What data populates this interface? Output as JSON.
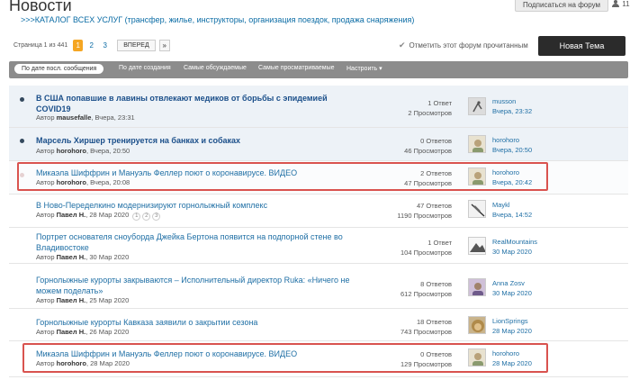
{
  "header": {
    "title": "Новости",
    "catalog_link": ">>>КАТАЛОГ ВСЕХ УСЛУГ (трансфер, жилье, инструкторы, организация поездок, продажа снаряжения)",
    "subscribe_label": "Подписаться на форум",
    "members_count": "11"
  },
  "pager": {
    "label": "Страница 1 из 441",
    "pages": [
      "1",
      "2",
      "3"
    ],
    "next_label": "ВПЕРЕД",
    "last_label": "»"
  },
  "actions": {
    "mark_read_label": "Отметить этот форум прочитанным",
    "new_topic_label": "Новая Тема"
  },
  "sort": {
    "items": [
      "По дате посл. сообщения",
      "По дате создания",
      "Самые обсуждаемые",
      "Самые просматриваемые",
      "Настроить ▾"
    ]
  },
  "topics": [
    {
      "title": "В США попавшие в лавины отвлекают медиков от борьбы с эпидемией COVID19",
      "author_prefix": "Автор",
      "author": "mausefalle",
      "date": ", Вчера, 23:31",
      "answers": "1 Ответ",
      "views": "2 Просмотров",
      "last_user": "musson",
      "last_when": "Вчера, 23:32"
    },
    {
      "title": "Марсель Хиршер тренируется на банках и собаках",
      "author_prefix": "Автор",
      "author": "horohoro",
      "date": ", Вчера, 20:50",
      "answers": "0 Ответов",
      "views": "46 Просмотров",
      "last_user": "horohoro",
      "last_when": "Вчера, 20:50"
    },
    {
      "title": "Микаэла Шиффрин и Мануэль Феллер поют о коронавирусе. ВИДЕО",
      "author_prefix": "Автор",
      "author": "horohoro",
      "date": ", Вчера, 20:08",
      "answers": "2 Ответов",
      "views": "47 Просмотров",
      "last_user": "horohoro",
      "last_when": "Вчера, 20:42"
    },
    {
      "title": "В Ново-Переделкино модернизируют горнолыжный комплекс",
      "author_prefix": "Автор",
      "author": "Павел Н.",
      "date": ", 28 Мар 2020",
      "pages": [
        "1",
        "2",
        "3"
      ],
      "answers": "47 Ответов",
      "views": "1190 Просмотров",
      "last_user": "Maykl",
      "last_when": "Вчера, 14:52"
    },
    {
      "title": "Портрет основателя сноуборда Джейка Бертона появится на подпорной стене во Владивостоке",
      "author_prefix": "Автор",
      "author": "Павел Н.",
      "date": ", 30 Мар 2020",
      "answers": "1 Ответ",
      "views": "104 Просмотров",
      "last_user": "RealMountains",
      "last_when": "30 Мар 2020"
    },
    {
      "title": "Горнолыжные курорты закрываются – Исполнительный директор Ruka: «Ничего не можем поделать»",
      "author_prefix": "Автор",
      "author": "Павел Н.",
      "date": ", 25 Мар 2020",
      "answers": "8 Ответов",
      "views": "612 Просмотров",
      "last_user": "Anna Zosv",
      "last_when": "30 Мар 2020"
    },
    {
      "title": "Горнолыжные курорты Кавказа заявили о закрытии сезона",
      "author_prefix": "Автор",
      "author": "Павел Н.",
      "date": ", 26 Мар 2020",
      "answers": "18 Ответов",
      "views": "743 Просмотров",
      "last_user": "LionSprings",
      "last_when": "28 Мар 2020"
    },
    {
      "title": "Микаэла Шиффрин и Мануэль Феллер поют о коронавирусе. ВИДЕО",
      "author_prefix": "Автор",
      "author": "horohoro",
      "date": ", 28 Мар 2020",
      "answers": "0 Ответов",
      "views": "129 Просмотров",
      "last_user": "horohoro",
      "last_when": "28 Мар 2020"
    }
  ],
  "colors": {
    "accent_link": "#1f6fa5",
    "active_page": "#f5a623",
    "highlight_box": "#d9534f",
    "new_topic_bg": "#2b2b2b",
    "sort_bar": "#8c8c8c"
  }
}
